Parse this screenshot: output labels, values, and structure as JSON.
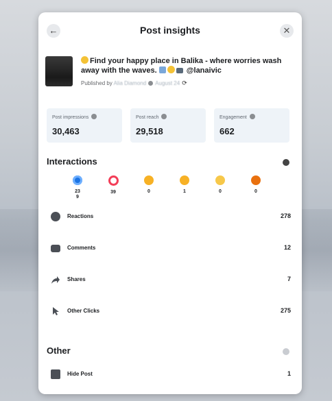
{
  "dialog": {
    "title": "Post insights"
  },
  "post": {
    "caption": "Find your happy place in Balika - where worries wash away with the waves.",
    "mention": "@lanaivic",
    "published_label": "Published by",
    "author": "Alia Diamond",
    "date": "August 24"
  },
  "stats": [
    {
      "label": "Post impressions",
      "value": "30,463"
    },
    {
      "label": "Post reach",
      "value": "29,518"
    },
    {
      "label": "Engagement",
      "value": "662"
    }
  ],
  "interactions": {
    "title": "Interactions",
    "reactions": [
      {
        "name": "like",
        "count": "23",
        "sub": "9"
      },
      {
        "name": "love",
        "count": "39",
        "sub": ""
      },
      {
        "name": "haha",
        "count": "0",
        "sub": ""
      },
      {
        "name": "wow",
        "count": "1",
        "sub": ""
      },
      {
        "name": "sad",
        "count": "0",
        "sub": ""
      },
      {
        "name": "angry",
        "count": "0",
        "sub": ""
      }
    ],
    "rows": [
      {
        "label": "Reactions",
        "value": "278",
        "icon": "smile-icon"
      },
      {
        "label": "Comments",
        "value": "12",
        "icon": "comment-icon"
      },
      {
        "label": "Shares",
        "value": "7",
        "icon": "share-arrow-icon"
      },
      {
        "label": "Other Clicks",
        "value": "275",
        "icon": "cursor-icon"
      }
    ]
  },
  "other": {
    "title": "Other",
    "rows": [
      {
        "label": "Hide Post",
        "value": "1",
        "icon": "hide-icon"
      }
    ]
  },
  "colors": {
    "like": "#1b74e4",
    "love": "#f33e58",
    "stat_bg": "#eef3f8"
  }
}
